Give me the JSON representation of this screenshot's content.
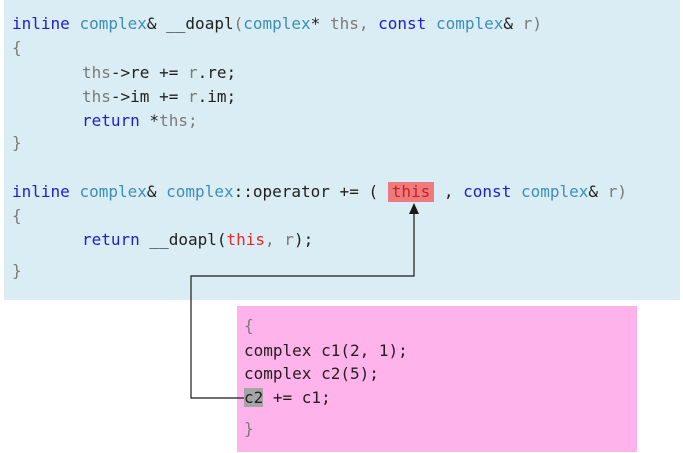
{
  "code_top": {
    "l1": {
      "kw": "inline",
      "t1": "complex",
      "amp1": "&",
      "fn": "__doapl",
      "p1": "(",
      "t2": "complex",
      "star": "*",
      "a1": "ths",
      "comma": ",",
      "k2": "const",
      "t3": "complex",
      "amp2": "&",
      "a2": "r",
      "p2": ")"
    },
    "l2": "{",
    "l3": {
      "a": "ths",
      "op": "->re += ",
      "b": "r",
      "c": ".re;"
    },
    "l4": {
      "a": "ths",
      "op": "->im += ",
      "b": "r",
      "c": ".im;"
    },
    "l5": {
      "kw": "return",
      "op": " *",
      "a": "ths",
      "semi": ";"
    },
    "l6": "}",
    "l7": {
      "kw": "inline",
      "t1": "complex",
      "amp": "&",
      "t2": "complex",
      "scope": "::operator += ( ",
      "this": "this",
      "mid": " , ",
      "k2": "const",
      "t3": "complex",
      "amp2": "&",
      "a": "r",
      "p2": ")"
    },
    "l8": "{",
    "l9": {
      "kw": "return",
      "fn": " __doapl(",
      "this": "this",
      "comma": ", ",
      "a": "r",
      "end": ");"
    },
    "l10": "}"
  },
  "code_bottom": {
    "l1": "{",
    "l2": "complex c1(2, 1);",
    "l3": "complex c2(5);",
    "l4_c2": "c2",
    "l4_rest": " += c1;",
    "l5": "}"
  },
  "colors": {
    "top_panel": "#daedf4",
    "bottom_panel": "#ffb3ea",
    "highlight_this": "#ee7b7b",
    "highlight_c2": "#a5a5a5",
    "keyword": "#1e1ecc",
    "type": "#3b8fb5",
    "this_red": "#e8282a"
  }
}
